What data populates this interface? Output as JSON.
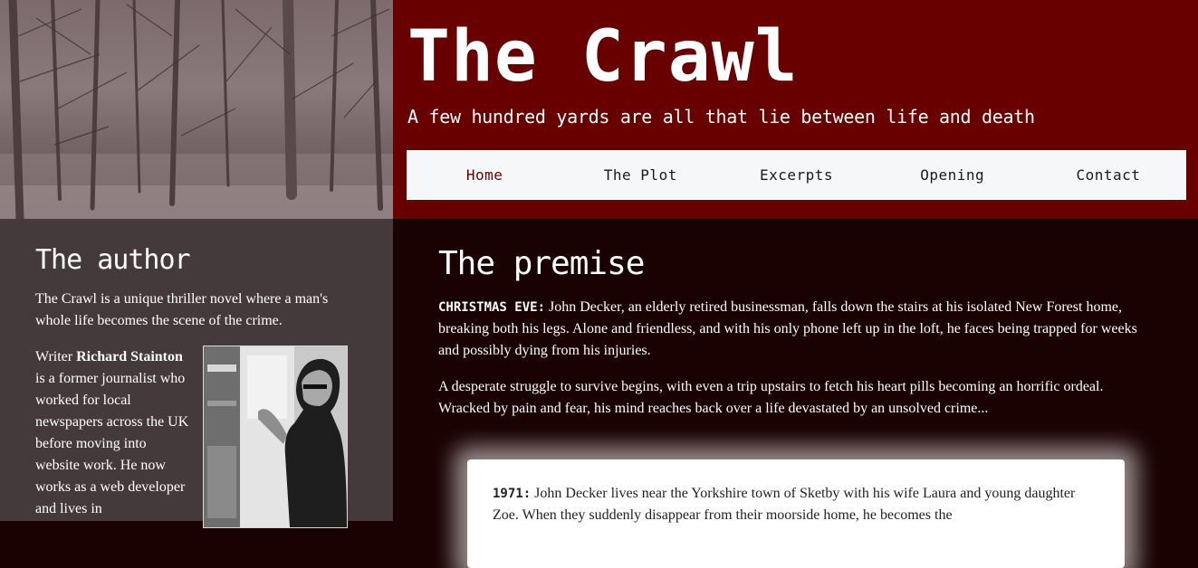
{
  "header": {
    "title": "The Crawl",
    "tagline": "A few hundred yards are all that lie between life and death"
  },
  "nav": {
    "items": [
      {
        "label": "Home"
      },
      {
        "label": "The Plot"
      },
      {
        "label": "Excerpts"
      },
      {
        "label": "Opening"
      },
      {
        "label": "Contact"
      }
    ]
  },
  "author": {
    "heading": "The author",
    "intro": "The Crawl is a unique thriller novel where a man's whole life becomes the scene of the crime.",
    "bio_prefix": "Writer ",
    "bio_name": "Richard Stainton",
    "bio_text": " is a former journalist who worked for local newspapers across the UK before moving into website work. He now works as a web developer and lives in"
  },
  "premise": {
    "heading": "The premise",
    "p1_lead": "CHRISTMAS EVE:",
    "p1_text": " John Decker, an elderly retired businessman, falls down the stairs at his isolated New Forest home, breaking both his legs. Alone and friendless, and with his only phone left up in the loft, he faces being trapped for weeks and possibly dying from his injuries.",
    "p2_text": "A desperate struggle to survive begins, with even a trip upstairs to fetch his heart pills becoming an horrific ordeal. Wracked by pain and fear, his mind reaches back over a life devastated by an unsolved crime..."
  },
  "card": {
    "lead": "1971:",
    "text": " John Decker lives near the Yorkshire town of Sketby with his wife Laura and young daughter Zoe. When they suddenly disappear from their moorside home, he becomes the"
  },
  "colors": {
    "banner": "#690000",
    "nav_active": "#690000",
    "sidebar": "#453a3b",
    "main_bg": "#1a0203"
  }
}
